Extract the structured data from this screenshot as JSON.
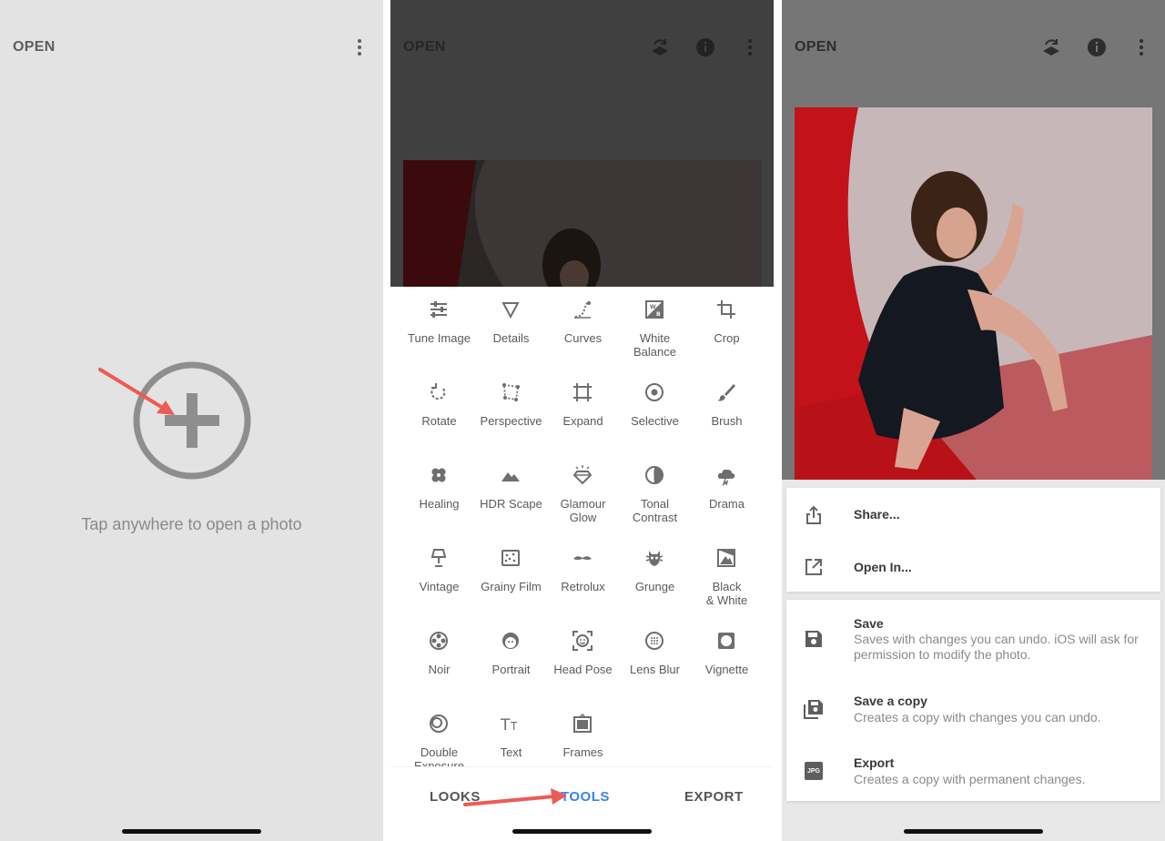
{
  "screen1": {
    "title": "OPEN",
    "prompt": "Tap anywhere to open a photo"
  },
  "screen2": {
    "title": "OPEN",
    "tools": [
      {
        "label": "Tune Image",
        "icon": "tune-icon"
      },
      {
        "label": "Details",
        "icon": "details-triangle-icon"
      },
      {
        "label": "Curves",
        "icon": "curves-icon"
      },
      {
        "label": "White\nBalance",
        "icon": "white-balance-icon"
      },
      {
        "label": "Crop",
        "icon": "crop-icon"
      },
      {
        "label": "Rotate",
        "icon": "rotate-icon"
      },
      {
        "label": "Perspective",
        "icon": "perspective-icon"
      },
      {
        "label": "Expand",
        "icon": "expand-icon"
      },
      {
        "label": "Selective",
        "icon": "selective-icon"
      },
      {
        "label": "Brush",
        "icon": "brush-icon"
      },
      {
        "label": "Healing",
        "icon": "healing-icon"
      },
      {
        "label": "HDR Scape",
        "icon": "hdr-scape-icon"
      },
      {
        "label": "Glamour\nGlow",
        "icon": "glamour-glow-icon"
      },
      {
        "label": "Tonal\nContrast",
        "icon": "tonal-contrast-icon"
      },
      {
        "label": "Drama",
        "icon": "drama-icon"
      },
      {
        "label": "Vintage",
        "icon": "vintage-icon"
      },
      {
        "label": "Grainy Film",
        "icon": "grainy-film-icon"
      },
      {
        "label": "Retrolux",
        "icon": "retrolux-icon"
      },
      {
        "label": "Grunge",
        "icon": "grunge-icon"
      },
      {
        "label": "Black\n& White",
        "icon": "black-white-icon"
      },
      {
        "label": "Noir",
        "icon": "noir-icon"
      },
      {
        "label": "Portrait",
        "icon": "portrait-icon"
      },
      {
        "label": "Head Pose",
        "icon": "head-pose-icon"
      },
      {
        "label": "Lens Blur",
        "icon": "lens-blur-icon"
      },
      {
        "label": "Vignette",
        "icon": "vignette-icon"
      },
      {
        "label": "Double\nExposure",
        "icon": "double-exposure-icon"
      },
      {
        "label": "Text",
        "icon": "text-icon"
      },
      {
        "label": "Frames",
        "icon": "frames-icon"
      }
    ],
    "tabs": {
      "looks": "LOOKS",
      "tools": "TOOLS",
      "export": "EXPORT"
    }
  },
  "screen3": {
    "title": "OPEN",
    "share_items": [
      {
        "title": "Share...",
        "icon": "share-icon"
      },
      {
        "title": "Open In...",
        "icon": "open-in-icon"
      }
    ],
    "save_items": [
      {
        "title": "Save",
        "desc": "Saves with changes you can undo. iOS will ask for permission to modify the photo.",
        "icon": "save-icon"
      },
      {
        "title": "Save a copy",
        "desc": "Creates a copy with changes you can undo.",
        "icon": "save-copy-icon"
      },
      {
        "title": "Export",
        "desc": "Creates a copy with permanent changes.",
        "icon": "jpg-export-icon",
        "badge": "JPG"
      }
    ]
  },
  "colors": {
    "accent": "#3b82e6",
    "arrow": "#ee5a55",
    "icon_gray": "#6e6e6e"
  }
}
